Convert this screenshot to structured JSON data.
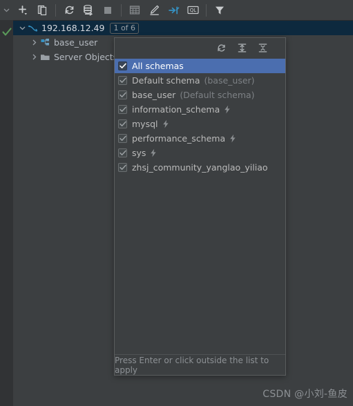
{
  "gutter": {
    "collapse_icon": "chevron-down-icon",
    "status_icon": "green-check-icon"
  },
  "toolbar": {
    "buttons": [
      {
        "name": "add-button",
        "icon": "plus-with-dropdown-icon",
        "label": "Add"
      },
      {
        "name": "duplicate-button",
        "icon": "copy-icon",
        "label": "Duplicate"
      },
      {
        "name": "refresh-button",
        "icon": "refresh-icon",
        "label": "Refresh"
      },
      {
        "name": "sync-scheme-button",
        "icon": "db-sync-icon",
        "label": "Synchronize"
      },
      {
        "name": "stop-button",
        "icon": "stop-square-icon",
        "label": "Stop"
      },
      {
        "name": "data-editor-button",
        "icon": "table-grid-icon",
        "label": "Data Editor"
      },
      {
        "name": "modify-button",
        "icon": "pencil-icon",
        "label": "Modify"
      },
      {
        "name": "jump-to-button",
        "icon": "jump-to-icon",
        "label": "Jump to Console"
      },
      {
        "name": "query-console-button",
        "icon": "ql-console-icon",
        "label": "Query Console"
      },
      {
        "name": "filter-button",
        "icon": "funnel-filter-icon",
        "label": "Filter"
      }
    ]
  },
  "tree": {
    "root": {
      "label": "192.168.12.49",
      "badge": "1 of 6",
      "icon": "mysql-dolphin-icon",
      "twisty": "chevron-down-icon"
    },
    "children": [
      {
        "label": "base_user",
        "icon": "schema-icon",
        "twisty": "chevron-right-icon"
      },
      {
        "label": "Server Objects",
        "icon": "folder-icon",
        "twisty": "chevron-right-icon"
      }
    ]
  },
  "popup": {
    "header_buttons": [
      {
        "name": "refresh-schemas-button",
        "icon": "refresh-icon"
      },
      {
        "name": "expand-all-button",
        "icon": "expand-all-icon"
      },
      {
        "name": "collapse-all-button",
        "icon": "collapse-all-icon"
      }
    ],
    "items": [
      {
        "name": "All schemas",
        "sub": "",
        "checked": true,
        "selected": true,
        "bolt": false
      },
      {
        "name": "Default schema",
        "sub": "(base_user)",
        "checked": true,
        "selected": false,
        "bolt": false
      },
      {
        "name": "base_user",
        "sub": "(Default schema)",
        "checked": true,
        "selected": false,
        "bolt": false
      },
      {
        "name": "information_schema",
        "sub": "",
        "checked": true,
        "selected": false,
        "bolt": true
      },
      {
        "name": "mysql",
        "sub": "",
        "checked": true,
        "selected": false,
        "bolt": true
      },
      {
        "name": "performance_schema",
        "sub": "",
        "checked": true,
        "selected": false,
        "bolt": true
      },
      {
        "name": "sys",
        "sub": "",
        "checked": true,
        "selected": false,
        "bolt": true
      },
      {
        "name": "zhsj_community_yanglao_yiliao",
        "sub": "",
        "checked": true,
        "selected": false,
        "bolt": false
      }
    ],
    "footer_hint": "Press Enter or click outside the list to apply"
  },
  "watermark": {
    "text": "CSDN @小刘-鱼皮"
  },
  "colors": {
    "background": "#3c3f41",
    "gutter": "#313335",
    "selection_blue": "#4b6eaf",
    "tree_selection": "#0d293e",
    "accent_blue": "#3592c4",
    "green_check": "#5a9b5a",
    "text": "#bbbbbb",
    "muted_text": "#7d8185"
  }
}
